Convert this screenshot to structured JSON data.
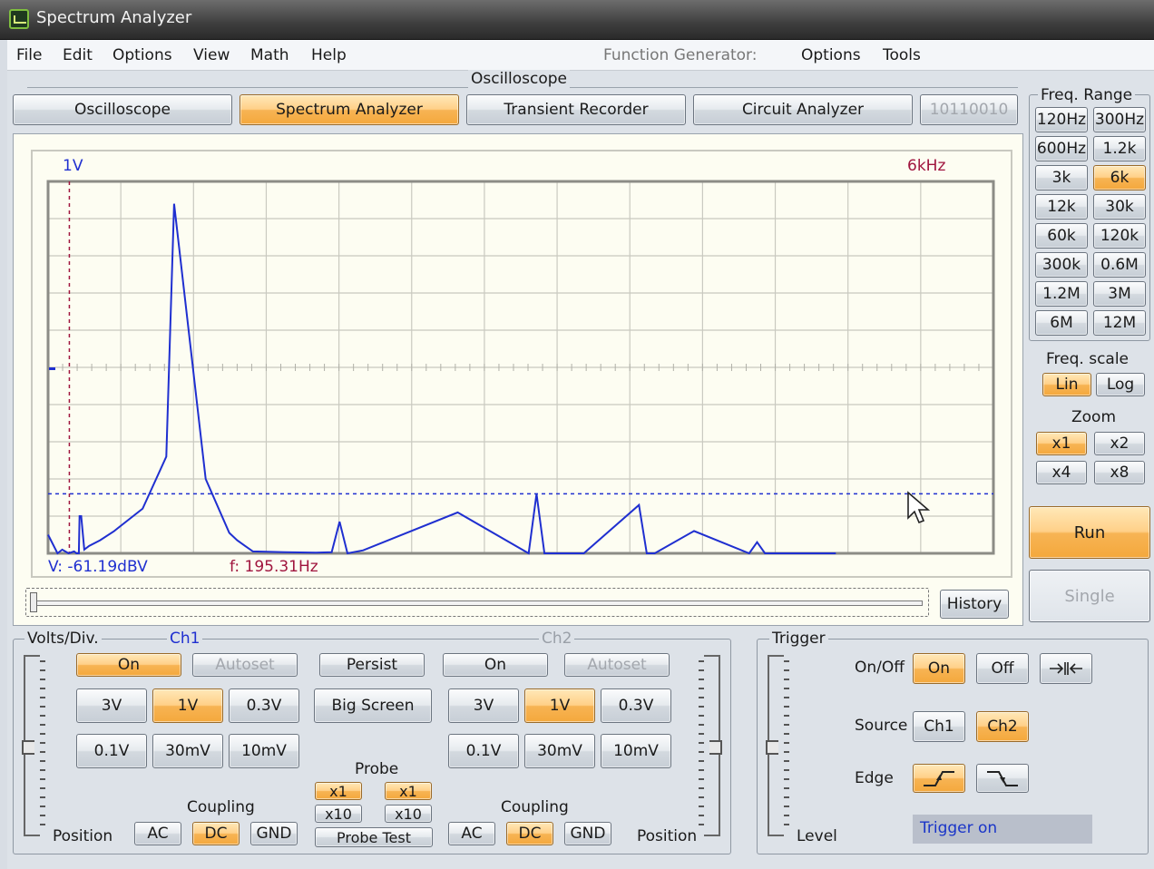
{
  "window": {
    "title": "Spectrum Analyzer"
  },
  "menu": {
    "items": [
      "File",
      "Edit",
      "Options",
      "View",
      "Math",
      "Help"
    ],
    "function_generator_label": "Function Generator:",
    "fg_items": [
      "Options",
      "Tools"
    ]
  },
  "mode": {
    "group_label": "Oscilloscope",
    "buttons": [
      {
        "label": "Oscilloscope",
        "active": false
      },
      {
        "label": "Spectrum Analyzer",
        "active": true
      },
      {
        "label": "Transient Recorder",
        "active": false
      },
      {
        "label": "Circuit Analyzer",
        "active": false
      },
      {
        "label": "10110010",
        "active": false,
        "disabled": true
      }
    ]
  },
  "display": {
    "ch1_scale": "1V",
    "freq_span": "6kHz",
    "readout_v": "V: -61.19dBV",
    "readout_f": "f: 195.31Hz",
    "history_label": "History",
    "trace_color": "#1f2fd0",
    "grid_color": "#c9c9c0",
    "marker_color": "#a0153e"
  },
  "freq_range": {
    "label": "Freq. Range",
    "options": [
      "120Hz",
      "300Hz",
      "600Hz",
      "1.2k",
      "3k",
      "6k",
      "12k",
      "30k",
      "60k",
      "120k",
      "300k",
      "0.6M",
      "1.2M",
      "3M",
      "6M",
      "12M"
    ],
    "selected": "6k"
  },
  "freq_scale": {
    "label": "Freq. scale",
    "options": [
      "Lin",
      "Log"
    ],
    "selected": "Lin"
  },
  "zoom": {
    "label": "Zoom",
    "options": [
      "x1",
      "x2",
      "x4",
      "x8"
    ],
    "selected": "x1"
  },
  "actions": {
    "run": "Run",
    "single": "Single"
  },
  "volts": {
    "label": "Volts/Div.",
    "ch1_label": "Ch1",
    "ch2_label": "Ch2",
    "on": "On",
    "autoset": "Autoset",
    "persist": "Persist",
    "big_screen": "Big Screen",
    "ranges": [
      "3V",
      "1V",
      "0.3V",
      "0.1V",
      "30mV",
      "10mV"
    ],
    "ch1_selected": "1V",
    "ch2_selected": "1V",
    "probe_label": "Probe",
    "probe_options": [
      "x1",
      "x10"
    ],
    "probe_test": "Probe Test",
    "coupling_label": "Coupling",
    "coupling_options": [
      "AC",
      "DC",
      "GND"
    ],
    "coupling_selected": "DC",
    "position_label": "Position"
  },
  "trigger": {
    "label": "Trigger",
    "onoff_label": "On/Off",
    "on": "On",
    "off": "Off",
    "source_label": "Source",
    "sources": [
      "Ch1",
      "Ch2"
    ],
    "source_selected": "Ch2",
    "edge_label": "Edge",
    "level_label": "Level",
    "status": "Trigger on"
  },
  "chart_data": {
    "type": "line",
    "x_unit": "Hz",
    "xlim": [
      0,
      6000
    ],
    "x": [
      0,
      60,
      90,
      130,
      165,
      180,
      195,
      200,
      210,
      230,
      260,
      330,
      420,
      600,
      750,
      800,
      1000,
      1150,
      1200,
      1250,
      1300,
      1500,
      1700,
      1800,
      1850,
      1900,
      2000,
      2600,
      3050,
      3100,
      3150,
      3400,
      3750,
      3800,
      3850,
      4100,
      4450,
      4500,
      4550,
      4800,
      5000
    ],
    "y_div": [
      0.5,
      0.0,
      0.1,
      0.0,
      0.05,
      0.0,
      0.0,
      1.0,
      1.0,
      0.1,
      0.2,
      0.35,
      0.6,
      1.2,
      2.6,
      9.4,
      2.0,
      0.55,
      0.35,
      0.2,
      0.05,
      0.03,
      0.02,
      0.03,
      0.85,
      0.0,
      0.08,
      1.1,
      0.0,
      1.6,
      0.0,
      0.0,
      1.3,
      0.0,
      0.0,
      0.6,
      0.0,
      0.3,
      0.0,
      0.0,
      0.0
    ],
    "ylim_div": [
      0,
      10
    ]
  }
}
